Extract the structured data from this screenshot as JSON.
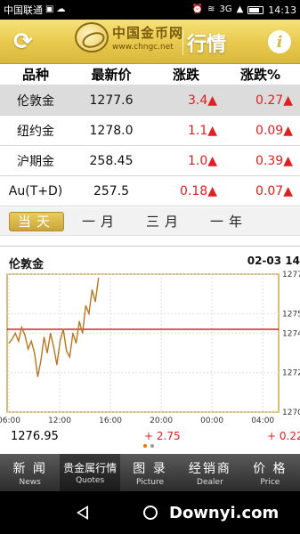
{
  "status_bar": {
    "carrier": "中国联通",
    "network": "3G",
    "time": "14:13"
  },
  "header": {
    "logo_cn": "中国金币网",
    "logo_url": "www.chngc.net",
    "title": "行情",
    "refresh_icon": "refresh-icon",
    "info_icon": "info-icon"
  },
  "table": {
    "headers": [
      "品种",
      "最新价",
      "涨跌",
      "涨跌%"
    ],
    "rows": [
      {
        "name": "伦敦金",
        "price": "1277.6",
        "change": "3.4▲",
        "pct": "0.27▲"
      },
      {
        "name": "纽约金",
        "price": "1278.0",
        "change": "1.1▲",
        "pct": "0.09▲"
      },
      {
        "name": "沪期金",
        "price": "258.45",
        "change": "1.0▲",
        "pct": "0.39▲"
      },
      {
        "name": "Au(T+D)",
        "price": "257.5",
        "change": "0.18▲",
        "pct": "0.07▲"
      }
    ]
  },
  "tabs": [
    "当天",
    "一月",
    "三月",
    "一年"
  ],
  "chart_section": {
    "name": "伦敦金",
    "datetime": "02-03 14",
    "current_price": "1276.95",
    "change": "+ 2.75",
    "change_pct": "+ 0.22"
  },
  "chart_data": {
    "type": "line",
    "title": "",
    "x_ticks": [
      "06:00",
      "12:00",
      "16:00",
      "20:00",
      "00:00",
      "04:00"
    ],
    "y_ticks": [
      "1277",
      "1275",
      "1274",
      "1272",
      "1270"
    ],
    "ylim": [
      1270,
      1277
    ],
    "reference_value": 1274.2,
    "series": [
      {
        "values": [
          1273.5,
          1273.7,
          1274.0,
          1273.6,
          1274.3,
          1273.9,
          1273.2,
          1273.6,
          1273.0,
          1271.8,
          1272.6,
          1273.8,
          1273.0,
          1274.0,
          1273.3,
          1272.4,
          1273.6,
          1274.2,
          1273.1,
          1272.8,
          1274.0,
          1273.5,
          1274.6,
          1274.0,
          1275.4,
          1275.0,
          1276.2,
          1275.6,
          1276.8
        ]
      }
    ],
    "colors": {
      "line": "#b8761e",
      "reference": "#c00000",
      "grid": "#dddddd",
      "frame": "#c8a84a"
    }
  },
  "bottom_nav": [
    {
      "cn": "新 闻",
      "en": "News"
    },
    {
      "cn": "贵金属行情",
      "en": "Quotes"
    },
    {
      "cn": "图 录",
      "en": "Picture"
    },
    {
      "cn": "经销商",
      "en": "Dealer"
    },
    {
      "cn": "价 格",
      "en": "Price"
    }
  ],
  "watermark": "Downyi.com"
}
